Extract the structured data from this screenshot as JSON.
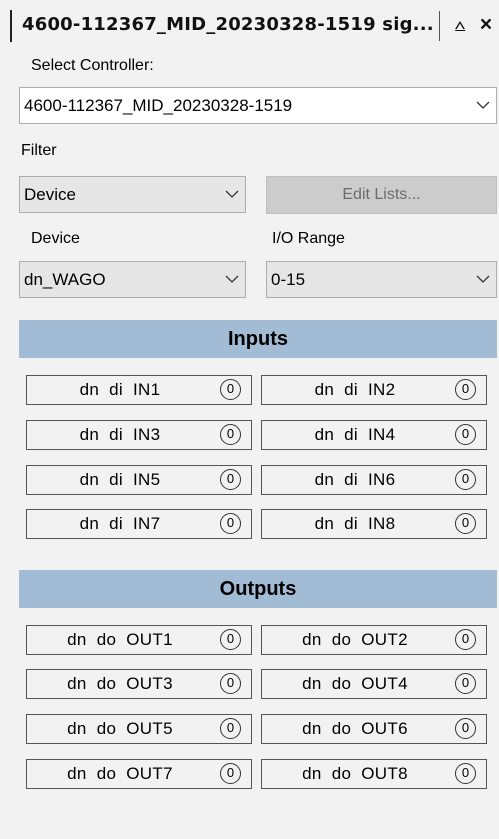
{
  "window": {
    "title": "4600-112367_MID_20230328-1519 sig...",
    "pin_glyph": "⩟",
    "close_glyph": "×"
  },
  "controller": {
    "label": "Select Controller:",
    "value": "4600-112367_MID_20230328-1519"
  },
  "filter": {
    "label": "Filter",
    "value": "Device",
    "edit_lists_label": "Edit Lists..."
  },
  "device": {
    "label": "Device",
    "value": "dn_WAGO"
  },
  "io_range": {
    "label": "I/O Range",
    "value": "0-15"
  },
  "inputs": {
    "header": "Inputs",
    "items": [
      {
        "label": "dn  di  IN1",
        "value": "0"
      },
      {
        "label": "dn  di  IN2",
        "value": "0"
      },
      {
        "label": "dn  di  IN3",
        "value": "0"
      },
      {
        "label": "dn  di  IN4",
        "value": "0"
      },
      {
        "label": "dn  di  IN5",
        "value": "0"
      },
      {
        "label": "dn  di  IN6",
        "value": "0"
      },
      {
        "label": "dn  di  IN7",
        "value": "0"
      },
      {
        "label": "dn  di  IN8",
        "value": "0"
      }
    ]
  },
  "outputs": {
    "header": "Outputs",
    "items": [
      {
        "label": "dn  do  OUT1",
        "value": "0"
      },
      {
        "label": "dn  do  OUT2",
        "value": "0"
      },
      {
        "label": "dn  do  OUT3",
        "value": "0"
      },
      {
        "label": "dn  do  OUT4",
        "value": "0"
      },
      {
        "label": "dn  do  OUT5",
        "value": "0"
      },
      {
        "label": "dn  do  OUT6",
        "value": "0"
      },
      {
        "label": "dn  do  OUT7",
        "value": "0"
      },
      {
        "label": "dn  do  OUT8",
        "value": "0"
      }
    ]
  },
  "colors": {
    "section_header_bg": "#a3bcd6",
    "panel_bg": "#f2f2f2",
    "disabled_button_bg": "#cccccc"
  }
}
